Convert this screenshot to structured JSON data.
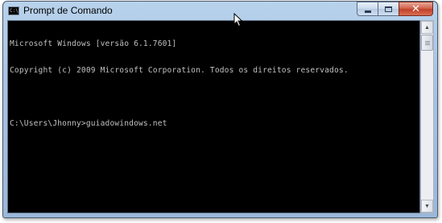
{
  "window": {
    "title": "Prompt de Comando",
    "icon_text": "C:\\"
  },
  "controls": {
    "minimize": "minimize-icon",
    "maximize": "maximize-icon",
    "close": "close-icon",
    "close_glyph": "✕"
  },
  "console": {
    "lines": [
      "Microsoft Windows [versão 6.1.7601]",
      "Copyright (c) 2009 Microsoft Corporation. Todos os direitos reservados.",
      "",
      "C:\\Users\\Jhonny>guiadowindows.net"
    ]
  },
  "scrollbar": {
    "up_glyph": "▲",
    "down_glyph": "▼"
  }
}
